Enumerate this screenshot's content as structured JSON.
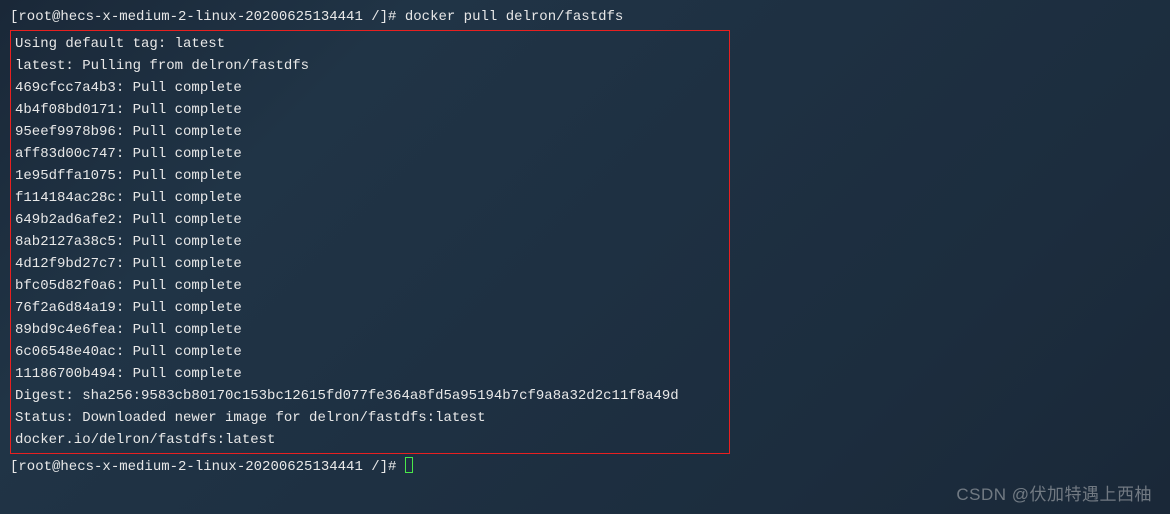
{
  "prompt1": {
    "user_host": "[root@hecs-x-medium-2-linux-20200625134441 /]# ",
    "command": "docker pull delron/fastdfs"
  },
  "output": {
    "lines": [
      "Using default tag: latest",
      "latest: Pulling from delron/fastdfs",
      "469cfcc7a4b3: Pull complete",
      "4b4f08bd0171: Pull complete",
      "95eef9978b96: Pull complete",
      "aff83d00c747: Pull complete",
      "1e95dffa1075: Pull complete",
      "f114184ac28c: Pull complete",
      "649b2ad6afe2: Pull complete",
      "8ab2127a38c5: Pull complete",
      "4d12f9bd27c7: Pull complete",
      "bfc05d82f0a6: Pull complete",
      "76f2a6d84a19: Pull complete",
      "89bd9c4e6fea: Pull complete",
      "6c06548e40ac: Pull complete",
      "11186700b494: Pull complete",
      "Digest: sha256:9583cb80170c153bc12615fd077fe364a8fd5a95194b7cf9a8a32d2c11f8a49d",
      "Status: Downloaded newer image for delron/fastdfs:latest",
      "docker.io/delron/fastdfs:latest"
    ]
  },
  "prompt2": {
    "user_host": "[root@hecs-x-medium-2-linux-20200625134441 /]# "
  },
  "watermark": "CSDN @伏加特遇上西柚"
}
